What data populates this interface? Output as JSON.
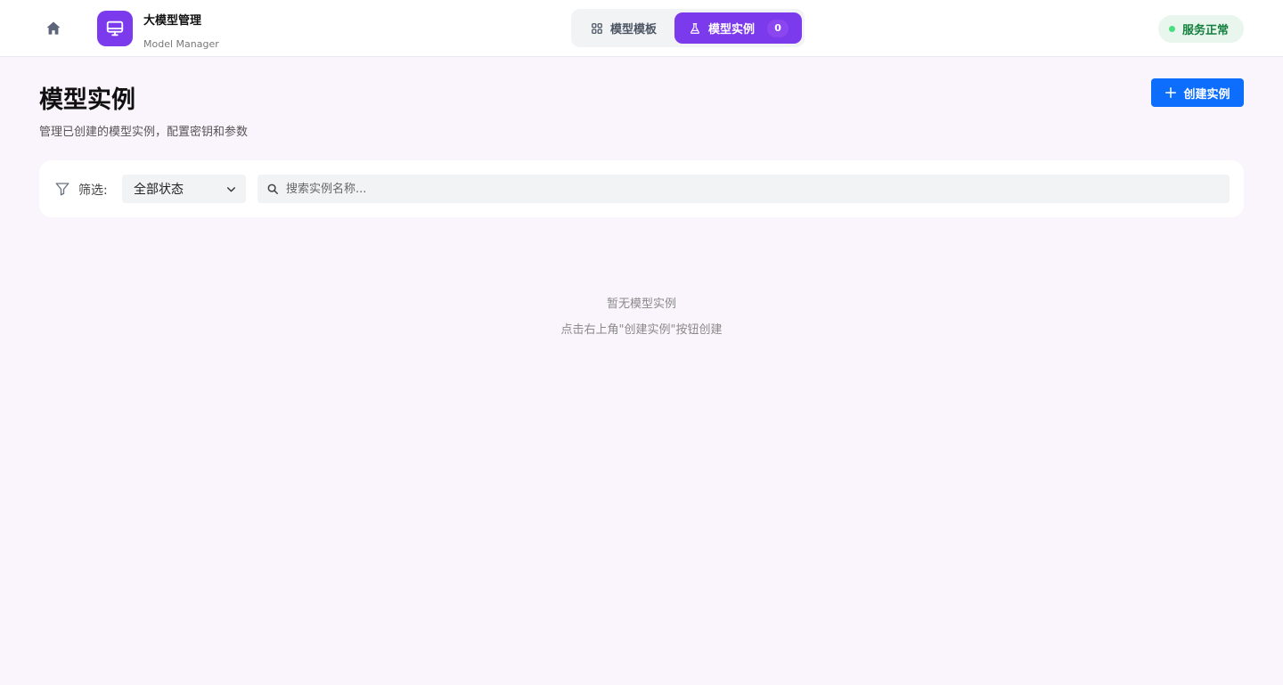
{
  "header": {
    "home_icon": "home-icon",
    "brand": {
      "icon": "monitor-icon",
      "title": "大模型管理",
      "subtitle": "Model Manager",
      "color": "#7c3aed"
    },
    "tabs": [
      {
        "label": "模型模板",
        "icon": "grid-icon",
        "active": false
      },
      {
        "label": "模型实例",
        "icon": "flask-icon",
        "active": true,
        "badge": "0"
      }
    ],
    "status": {
      "label": "服务正常",
      "color": "#15803d",
      "dot_color": "#4ade80"
    }
  },
  "page": {
    "title": "模型实例",
    "description": "管理已创建的模型实例，配置密钥和参数",
    "create_button": {
      "label": "创建实例",
      "icon": "plus-icon",
      "color": "#0d6efd"
    }
  },
  "filter": {
    "label": "筛选:",
    "icon": "filter-icon",
    "status_select": {
      "value": "全部状态",
      "icon": "chevron-down-icon"
    },
    "search": {
      "placeholder": "搜索实例名称...",
      "value": "",
      "icon": "search-icon"
    }
  },
  "empty_state": {
    "title": "暂无模型实例",
    "hint": "点击右上角\"创建实例\"按钮创建"
  }
}
